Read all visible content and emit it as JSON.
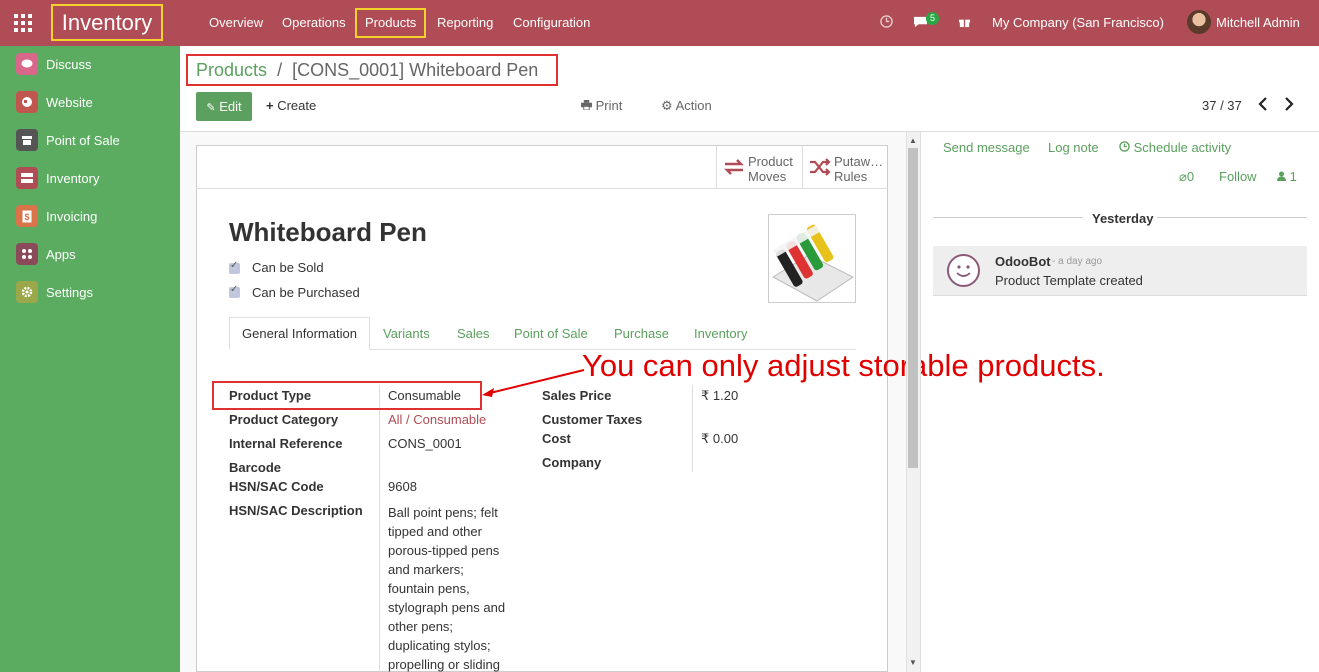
{
  "topbar": {
    "app_title": "Inventory",
    "menu": [
      "Overview",
      "Operations",
      "Products",
      "Reporting",
      "Configuration"
    ],
    "messages_badge": "5",
    "company": "My Company (San Francisco)",
    "user": "Mitchell Admin",
    "colors": {
      "bar": "#b04c55",
      "highlight": "#f2d22b"
    }
  },
  "sidebar": {
    "items": [
      {
        "label": "Discuss",
        "icon": "chat-icon",
        "color": "#d9678a"
      },
      {
        "label": "Website",
        "icon": "globe-icon",
        "color": "#c0574f"
      },
      {
        "label": "Point of Sale",
        "icon": "store-icon",
        "color": "#555555"
      },
      {
        "label": "Inventory",
        "icon": "boxes-icon",
        "color": "#b04c55"
      },
      {
        "label": "Invoicing",
        "icon": "invoice-icon",
        "color": "#d9744a"
      },
      {
        "label": "Apps",
        "icon": "apps-icon",
        "color": "#8a4a5a"
      },
      {
        "label": "Settings",
        "icon": "gear-icon",
        "color": "#9aa84a"
      }
    ],
    "color": "#5bac61"
  },
  "breadcrumb": {
    "parent": "Products",
    "separator": "/",
    "current": "[CONS_0001] Whiteboard Pen"
  },
  "toolbar": {
    "edit": "Edit",
    "create": "Create",
    "print": "Print",
    "action": "Action",
    "pager": "37 / 37"
  },
  "stat_buttons": [
    {
      "line1": "Product",
      "line2": "Moves",
      "icon": "swap-arrows-icon"
    },
    {
      "line1": "Putaw…",
      "line2": "Rules",
      "icon": "shuffle-icon"
    }
  ],
  "product": {
    "name": "Whiteboard Pen",
    "can_be_sold": "Can be Sold",
    "can_be_purchased": "Can be Purchased"
  },
  "tabs": [
    "General Information",
    "Variants",
    "Sales",
    "Point of Sale",
    "Purchase",
    "Inventory"
  ],
  "fields_left": {
    "product_type": {
      "label": "Product Type",
      "value": "Consumable"
    },
    "product_category": {
      "label": "Product Category",
      "value": "All / Consumable"
    },
    "internal_reference": {
      "label": "Internal Reference",
      "value": "CONS_0001"
    },
    "barcode": {
      "label": "Barcode",
      "value": ""
    },
    "hsn_code": {
      "label": "HSN/SAC Code",
      "value": "9608"
    },
    "hsn_desc": {
      "label": "HSN/SAC Description",
      "value": "Ball point pens; felt tipped and other porous-tipped pens and markers; fountain pens, stylograph pens and other pens; duplicating stylos; propelling or sliding"
    }
  },
  "fields_right": {
    "sales_price": {
      "label": "Sales Price",
      "value": "₹ 1.20"
    },
    "customer_taxes": {
      "label": "Customer Taxes",
      "value": ""
    },
    "cost": {
      "label": "Cost",
      "value": "₹ 0.00"
    },
    "company": {
      "label": "Company",
      "value": ""
    }
  },
  "annotation": "You can only adjust storable products.",
  "chatter": {
    "send_message": "Send message",
    "log_note": "Log note",
    "schedule_activity": "Schedule activity",
    "attachments": "0",
    "follow": "Follow",
    "followers": "1",
    "date_separator": "Yesterday",
    "message": {
      "author": "OdooBot",
      "time": "- a day ago",
      "body": "Product Template created"
    }
  }
}
